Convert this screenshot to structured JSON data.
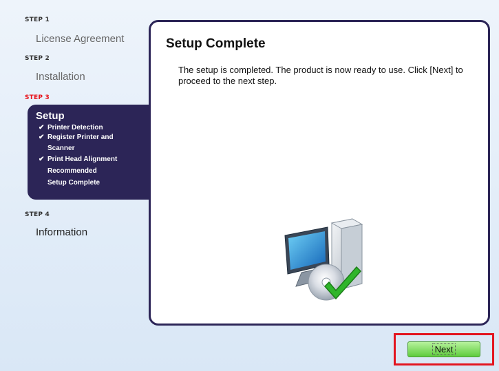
{
  "sidebar": {
    "steps": [
      {
        "label": "STEP 1",
        "title": "License Agreement"
      },
      {
        "label": "STEP 2",
        "title": "Installation"
      },
      {
        "label": "STEP 3",
        "title": "Setup"
      },
      {
        "label": "STEP 4",
        "title": "Information"
      }
    ],
    "active_items": [
      {
        "check": "✔",
        "text": "Printer Detection"
      },
      {
        "check": "✔",
        "text": "Register Printer and"
      },
      {
        "check": "",
        "text": "Scanner"
      },
      {
        "check": "✔",
        "text": "Print Head Alignment"
      },
      {
        "check": "",
        "text": "Recommended"
      },
      {
        "check": "",
        "text": "Setup Complete"
      }
    ]
  },
  "content": {
    "heading": "Setup Complete",
    "message": "The setup is completed. The product is now ready to use. Click [Next] to proceed to the next step.",
    "illustration_icon": "computer-with-disc-and-check-icon"
  },
  "footer": {
    "next_label": "Next"
  },
  "colors": {
    "panel": "#2c2557",
    "active_step_label": "#e8131b",
    "highlight": "#e3141f",
    "button_top": "#b6f29c",
    "button_bottom": "#5fcc3d",
    "check_green": "#2fb52a"
  }
}
